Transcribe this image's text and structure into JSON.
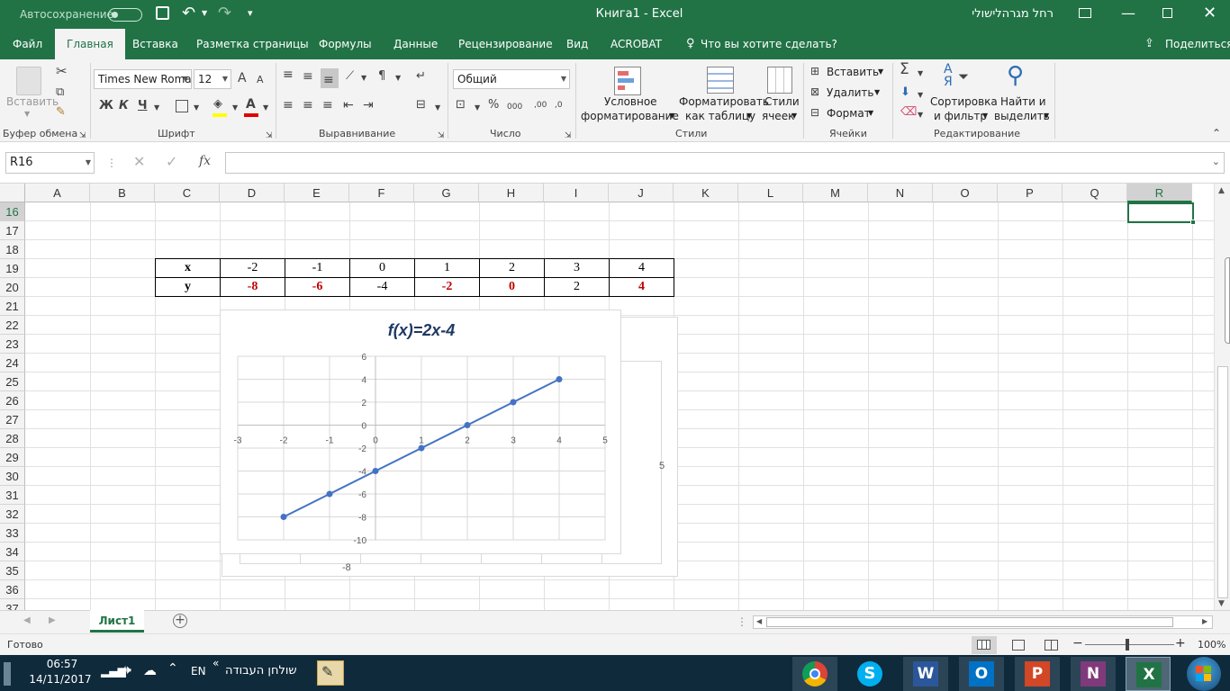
{
  "titlebar": {
    "autosave_label": "Автосохранение",
    "title": "Книга1  -  Excel",
    "user": "רחל מגרהלישולי"
  },
  "tabs": [
    "Файл",
    "Главная",
    "Вставка",
    "Разметка страницы",
    "Формулы",
    "Данные",
    "Рецензирование",
    "Вид",
    "ACROBAT"
  ],
  "active_tab": "Главная",
  "tell_me": "Что вы хотите сделать?",
  "share": "Поделиться",
  "ribbon": {
    "clipboard": {
      "paste": "Вставить",
      "label": "Буфер обмена"
    },
    "font": {
      "name": "Times New Roma",
      "size": "12",
      "bold": "Ж",
      "italic": "К",
      "underline": "Ч",
      "label": "Шрифт",
      "grow": "A",
      "shrink": "A"
    },
    "alignment": {
      "label": "Выравнивание"
    },
    "number": {
      "format": "Общий",
      "label": "Число",
      "percent": "%",
      "thousands": "000",
      "inc_dec": ",00",
      "dec_dec": ",0"
    },
    "styles": {
      "conditional_1": "Условное",
      "conditional_2": "форматирование",
      "table_1": "Форматировать",
      "table_2": "как таблицу",
      "cell_1": "Стили",
      "cell_2": "ячеек",
      "label": "Стили"
    },
    "cells": {
      "insert": "Вставить",
      "delete": "Удалить",
      "format": "Формат",
      "label": "Ячейки"
    },
    "editing": {
      "sort_1": "Сортировка",
      "sort_2": "и фильтр",
      "find_1": "Найти и",
      "find_2": "выделить",
      "label": "Редактирование"
    }
  },
  "formula_bar": {
    "name_box": "R16",
    "fx": "fx",
    "value": ""
  },
  "columns": [
    "A",
    "B",
    "C",
    "D",
    "E",
    "F",
    "G",
    "H",
    "I",
    "J",
    "K",
    "L",
    "M",
    "N",
    "O",
    "P",
    "Q",
    "R"
  ],
  "rows": [
    "16",
    "17",
    "18",
    "19",
    "20",
    "21",
    "22",
    "23",
    "24",
    "25",
    "26",
    "27",
    "28",
    "29",
    "30",
    "31",
    "32",
    "33",
    "34",
    "35",
    "36",
    "37"
  ],
  "table": {
    "x_label": "x",
    "y_label": "y",
    "x": [
      "-2",
      "-1",
      "0",
      "1",
      "2",
      "3",
      "4"
    ],
    "y": [
      "-8",
      "-6",
      "-4",
      "-2",
      "0",
      "2",
      "4"
    ],
    "y_red": [
      true,
      true,
      false,
      true,
      true,
      false,
      true
    ]
  },
  "back_chart": {
    "ytick": "-8",
    "xtick": "5"
  },
  "chart_data": {
    "type": "scatter",
    "title": "f(x)=2x-4",
    "x": [
      -2,
      -1,
      0,
      1,
      2,
      3,
      4
    ],
    "y": [
      -8,
      -6,
      -4,
      -2,
      0,
      2,
      4
    ],
    "xlim": [
      -3,
      5
    ],
    "ylim": [
      -10,
      6
    ],
    "xticks": [
      "-3",
      "-2",
      "-1",
      "0",
      "1",
      "2",
      "3",
      "4",
      "5"
    ],
    "yticks": [
      "6",
      "4",
      "2",
      "0",
      "-2",
      "-4",
      "-6",
      "-8",
      "-10"
    ],
    "grid": true,
    "line_color": "#4472c4"
  },
  "sheet_tab": "Лист1",
  "status": {
    "ready": "Готово",
    "zoom": "100%"
  },
  "taskbar": {
    "time": "06:57",
    "date": "14/11/2017",
    "lang": "EN",
    "desktop": "שולחן העבודה",
    "chevron": "«",
    "apps": [
      "chrome",
      "skype",
      "word",
      "outlook",
      "powerpoint",
      "onenote",
      "excel"
    ]
  },
  "colors": {
    "excel_green": "#217346",
    "red_value": "#c00000",
    "taskbar": "#0f2a3b"
  }
}
